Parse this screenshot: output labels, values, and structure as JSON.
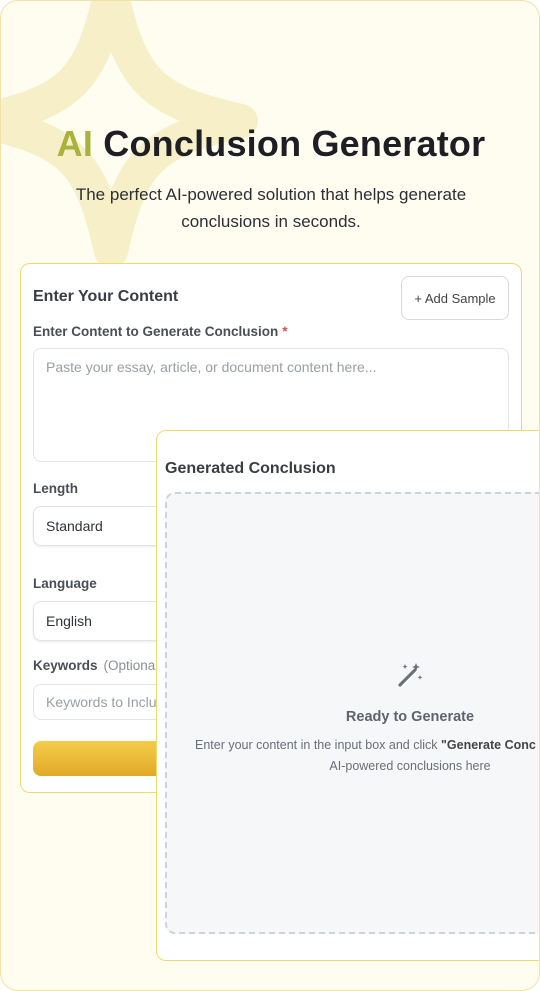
{
  "header": {
    "title_accent": "AI",
    "title_rest": "Conclusion Generator",
    "subtitle": "The perfect AI-powered solution that helps generate conclusions in seconds."
  },
  "input_card": {
    "heading": "Enter Your Content",
    "add_sample_label": "+ Add Sample",
    "content_label": "Enter Content to Generate Conclusion",
    "required_mark": "*",
    "content_placeholder": "Paste your essay, article, or document content here...",
    "length_label": "Length",
    "length_value": "Standard",
    "language_label": "Language",
    "language_value": "English",
    "keywords_label": "Keywords",
    "keywords_optional": "(Optiona",
    "keywords_placeholder": "Keywords to Inclu"
  },
  "output_card": {
    "heading": "Generated Conclusion",
    "icon": "magic-wand-icon",
    "ready_title": "Ready to Generate",
    "ready_desc_prefix": "Enter your content in the input box and click ",
    "ready_desc_bold": "\"Generate Conc",
    "ready_desc_line2": "AI-powered conclusions here"
  },
  "colors": {
    "accent": "#a9b23a",
    "button_gradient_top": "#f3cd4a",
    "button_gradient_bottom": "#e2a928",
    "card_border": "#f0d96b",
    "background": "#fffdf0"
  }
}
